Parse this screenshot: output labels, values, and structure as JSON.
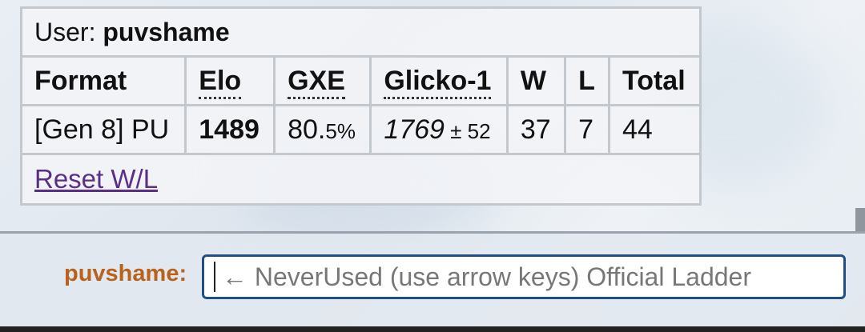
{
  "ladder": {
    "user_label": "User: ",
    "username": "puvshame",
    "headers": [
      "Format",
      "Elo",
      "GXE",
      "Glicko-1",
      "W",
      "L",
      "Total"
    ],
    "row": {
      "format": "[Gen 8] PU",
      "elo": "1489",
      "gxe_main": "80.",
      "gxe_small": "5%",
      "glicko": "1769",
      "glicko_dev": " ± 52",
      "w": "37",
      "l": "7",
      "total": "44"
    },
    "reset_label": "Reset W/L"
  },
  "compose": {
    "name_label": "puvshame:",
    "placeholder": "← NeverUsed (use arrow keys) Official Ladder"
  },
  "colors": {
    "name_label": "#b8621b",
    "link": "#5b2f86",
    "input_border": "#1f4f86"
  }
}
